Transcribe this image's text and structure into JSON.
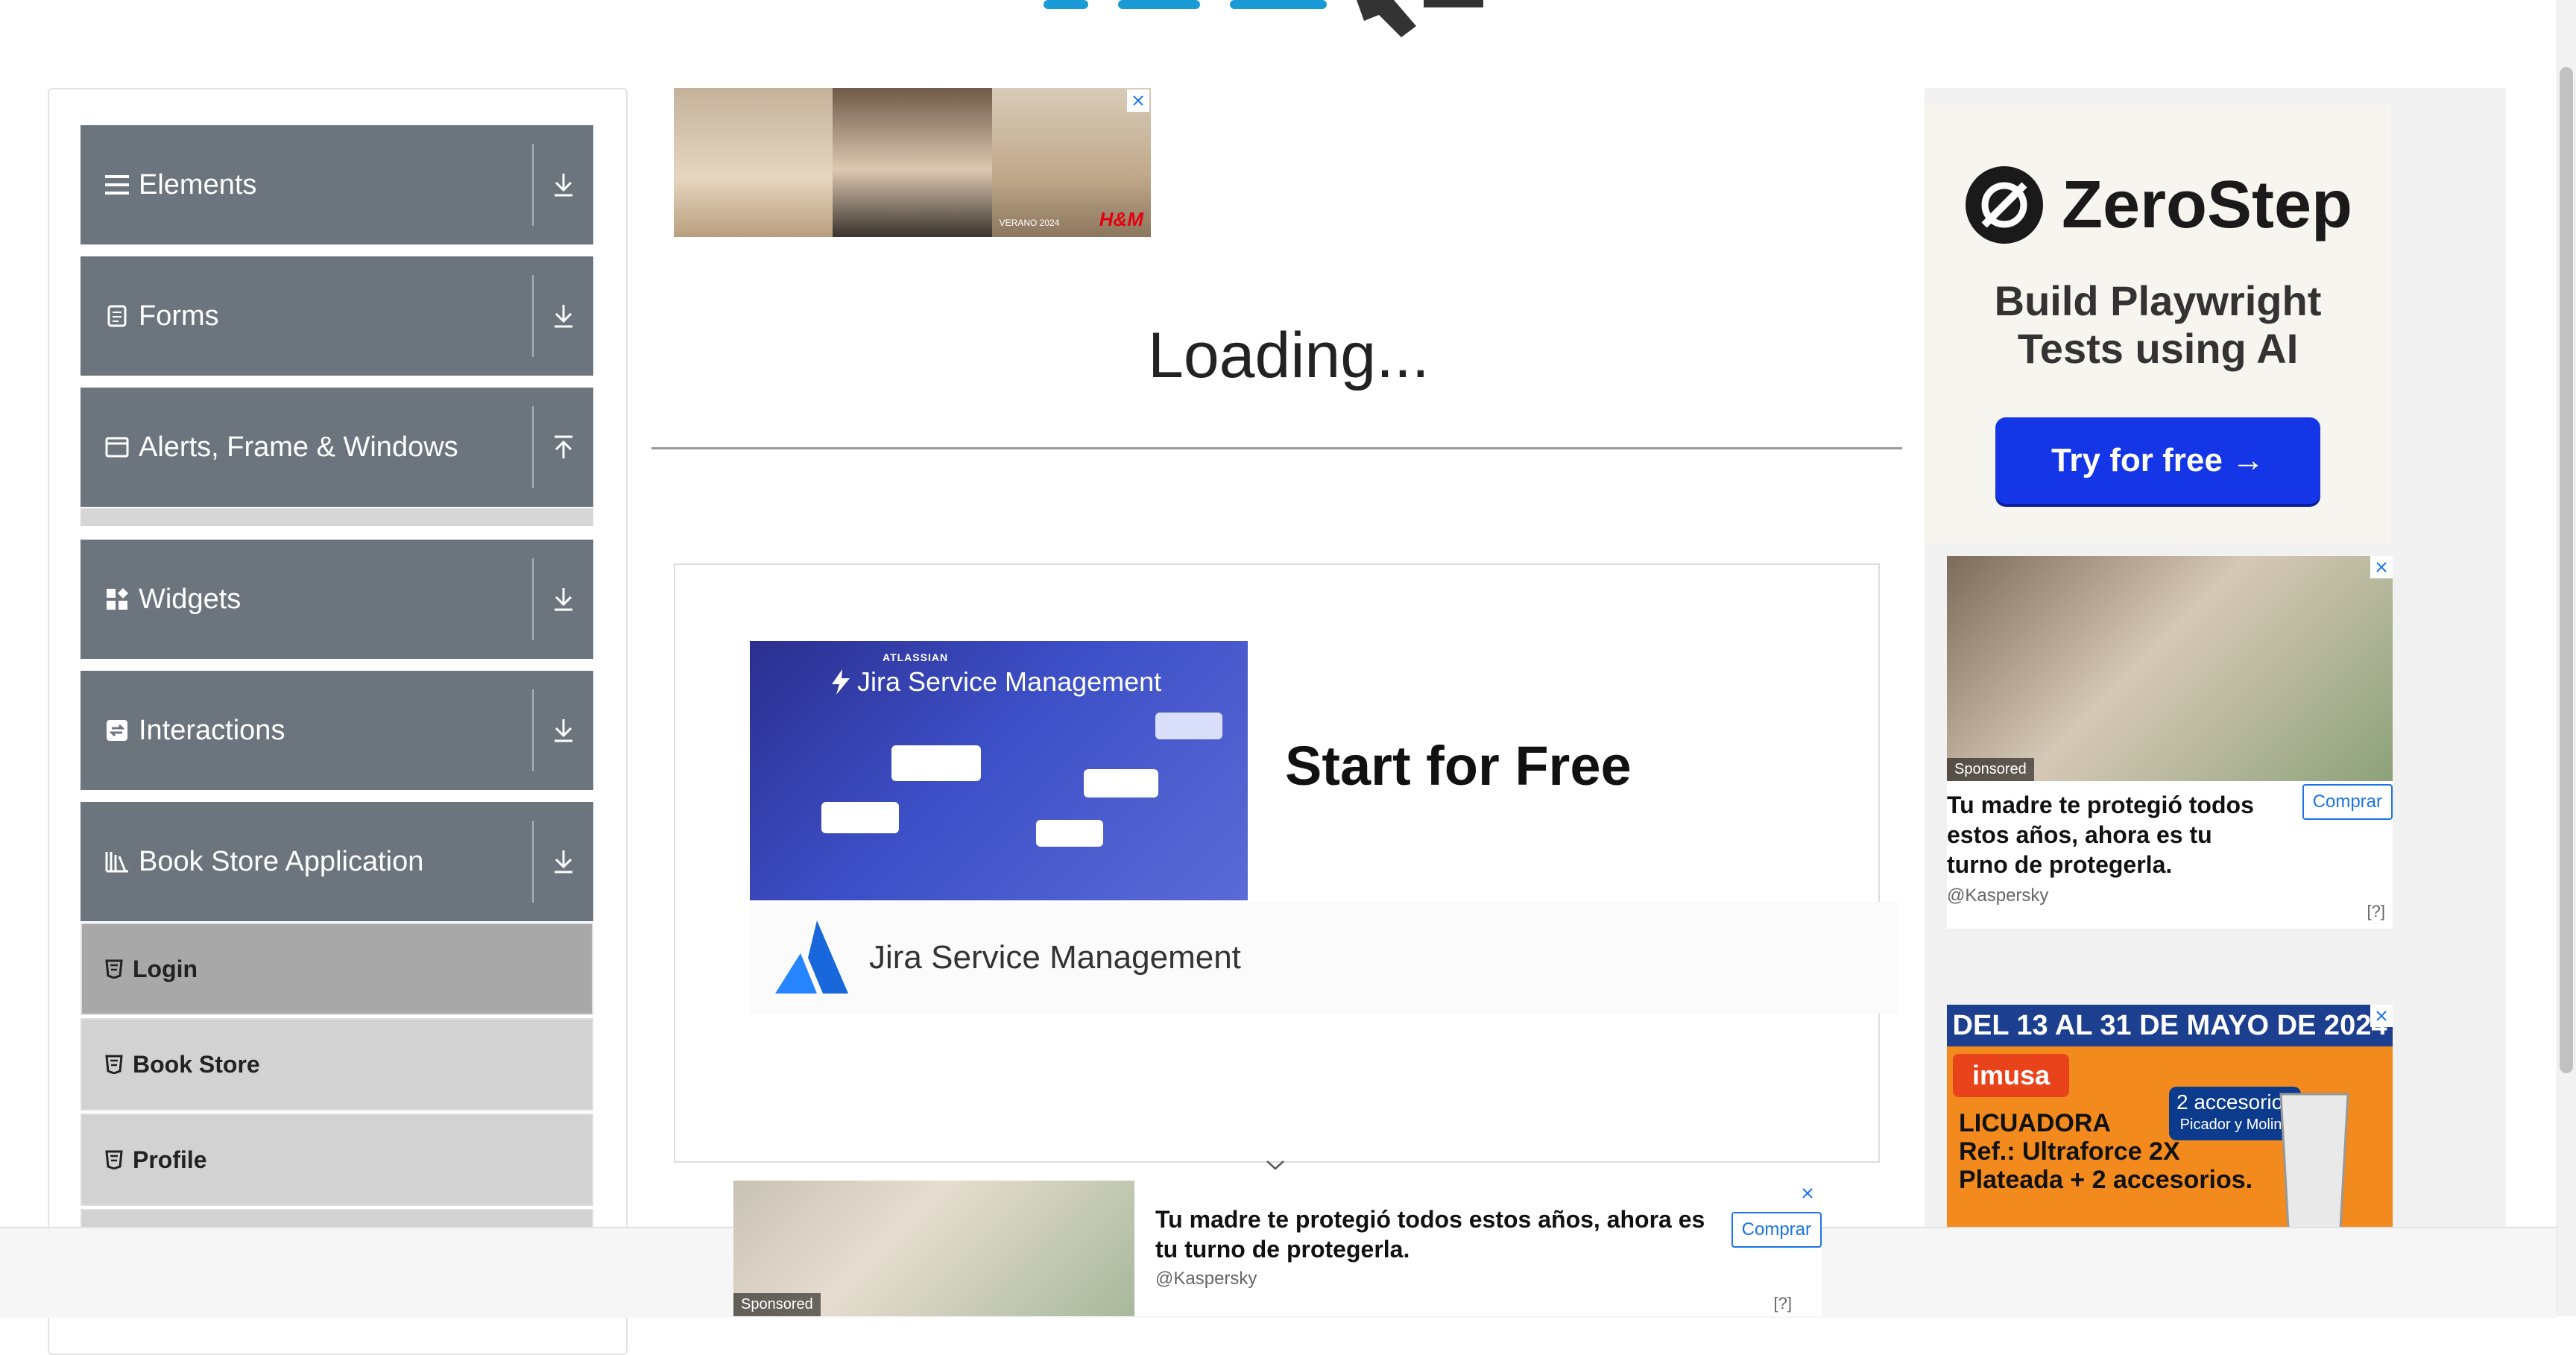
{
  "sidebar": {
    "groups": [
      {
        "label": "Elements",
        "icon": "menu-icon"
      },
      {
        "label": "Forms",
        "icon": "document-icon"
      },
      {
        "label": "Alerts, Frame & Windows",
        "icon": "window-icon"
      },
      {
        "label": "Widgets",
        "icon": "widgets-icon"
      },
      {
        "label": "Interactions",
        "icon": "interactions-icon"
      },
      {
        "label": "Book Store Application",
        "icon": "books-icon"
      }
    ],
    "book_store_items": [
      "Login",
      "Book Store",
      "Profile"
    ]
  },
  "main": {
    "loading_text": "Loading...",
    "jira_ad": {
      "banner_brand_small": "ATLASSIAN",
      "banner_product": "Jira Service Management",
      "cta": "Start for Free",
      "footer_name": "Jira Service Management"
    },
    "top_ad": {
      "caption": "VERANO 2024",
      "brand": "H&M"
    }
  },
  "right_ads": {
    "zerostep": {
      "brand": "ZeroStep",
      "tagline_line1": "Build Playwright",
      "tagline_line2": "Tests using AI",
      "button": "Try for free →"
    },
    "kaspersky": {
      "sponsored": "Sponsored",
      "title": "Tu madre te protegió todos estos años, ahora es tu turno de protegerla.",
      "handle": "@Kaspersky",
      "button": "Comprar",
      "help": "[?]"
    },
    "imusa": {
      "header": "DEL 13 AL 31 DE MAYO DE 2024",
      "brand": "imusa",
      "product_line1": "LICUADORA",
      "product_line2": "Ref.: Ultraforce 2X",
      "product_line3": "Plateada + 2 accesorios.",
      "accessories_line1": "2 accesorios",
      "accessories_line2": "Picador y Molino"
    }
  },
  "bottom_ad": {
    "sponsored": "Sponsored",
    "title": "Tu madre te protegió todos estos años, ahora es tu turno de protegerla.",
    "handle": "@Kaspersky",
    "button": "Comprar",
    "help": "[?]"
  },
  "colors": {
    "sidebar_group_bg": "#6c757d",
    "login_bg": "#a8a8a8",
    "subitem_bg": "#d2d2d2",
    "zerostep_button": "#1436e6",
    "link_blue": "#1a73e8"
  }
}
